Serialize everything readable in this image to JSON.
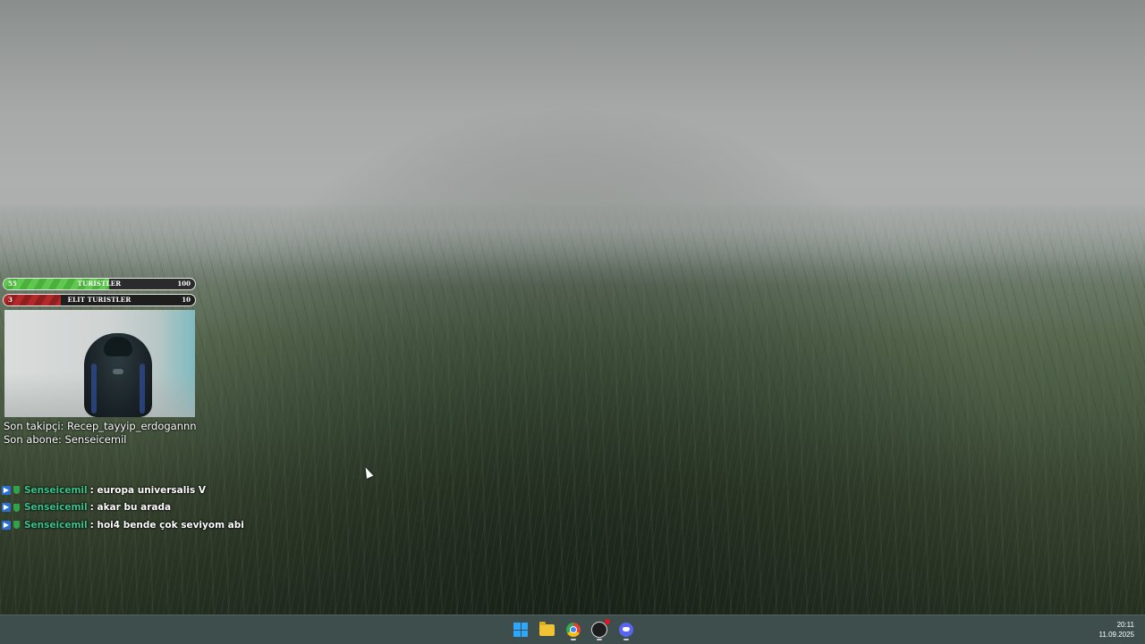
{
  "goal_bars": [
    {
      "left": "55",
      "label": "TURISTLER",
      "right": "100",
      "progress": 0.55
    },
    {
      "left": "3",
      "label": "ELIT TURISTLER",
      "right": "10",
      "progress": 0.3
    }
  ],
  "stream_info": {
    "last_follower": "Son takipçi: Recep_tayyip_erdogannn",
    "last_subscriber": "Son abone: Senseicemil"
  },
  "chat": [
    {
      "user": "Senseicemil",
      "message": ": europa universalis V"
    },
    {
      "user": "Senseicemil",
      "message": ": akar bu arada"
    },
    {
      "user": "Senseicemil",
      "message": ": hoi4 bende çok seviyom abi"
    }
  ],
  "taskbar": {
    "apps": [
      "windows-start-icon",
      "file-explorer-icon",
      "chrome-icon",
      "obs-studio-icon",
      "discord-icon"
    ],
    "time": "20:11",
    "date": "11.09.2025"
  },
  "colors": {
    "goal_green": "#5fc94f",
    "goal_red": "#b32828",
    "chat_username": "#3ac58d",
    "taskbar_bg": "#3e4e4c"
  }
}
